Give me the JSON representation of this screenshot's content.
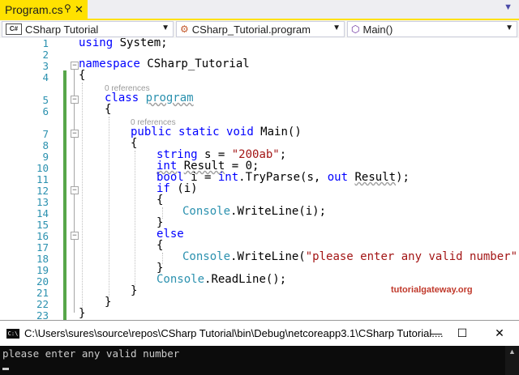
{
  "tab": {
    "title": "Program.cs",
    "pin_icon": "pin-icon",
    "close_glyph": "✕"
  },
  "nav": {
    "project": "CSharp Tutorial",
    "project_icon_text": "C#",
    "class": "CSharp_Tutorial.program",
    "member": "Main()"
  },
  "editor": {
    "line_numbers": [
      "1",
      "2",
      "3",
      "4",
      "5",
      "6",
      "7",
      "8",
      "9",
      "10",
      "11",
      "12",
      "13",
      "14",
      "15",
      "16",
      "17",
      "18",
      "19",
      "20",
      "21",
      "22",
      "23"
    ],
    "codelens_class": "0 references",
    "codelens_method": "0 references",
    "watermark": "tutorialgateway.org"
  },
  "code": {
    "l1_using": "using",
    "l1_rest": " System;",
    "l3_ns": "namespace",
    "l3_rest": " CSharp_Tutorial",
    "l4": "{",
    "l5_kw": "class",
    "l5_name": "program",
    "l6": "{",
    "l7_public": "public",
    "l7_static": "static",
    "l7_void": "void",
    "l7_rest": " Main()",
    "l8": "{",
    "l9_type": "string",
    "l9_mid": " s = ",
    "l9_str": "\"200ab\"",
    "l9_end": ";",
    "l10_type": "int",
    "l10_var": "Result",
    "l10_rest": " = 0;",
    "l11_type": "bool",
    "l11_mid": " i = ",
    "l11_int": "int",
    "l11_call": ".TryParse(s, ",
    "l11_out": "out",
    "l11_arg": "Result",
    "l11_end": ");",
    "l12_if": "if",
    "l12_rest": " (i)",
    "l13": "{",
    "l14_console": "Console",
    "l14_rest": ".WriteLine(i);",
    "l15": "}",
    "l16_else": "else",
    "l17": "{",
    "l18_console": "Console",
    "l18_mid": ".WriteLine(",
    "l18_str": "\"please enter any valid number\"",
    "l18_end": ");",
    "l19": "}",
    "l20_console": "Console",
    "l20_rest": ".ReadLine();",
    "l21": "}",
    "l22": "}",
    "l23": "}"
  },
  "console": {
    "title": "C:\\Users\\sures\\source\\repos\\CSharp Tutorial\\bin\\Debug\\netcoreapp3.1\\CSharp Tutorial....",
    "icon_text": "C:\\",
    "output": "please enter any valid number",
    "minimize": "—",
    "maximize": "☐",
    "close": "✕"
  },
  "colors": {
    "keyword": "#0000ff",
    "type": "#2b91af",
    "string": "#a31515",
    "tab_active": "#ffe100",
    "line_number": "#2b91af"
  }
}
